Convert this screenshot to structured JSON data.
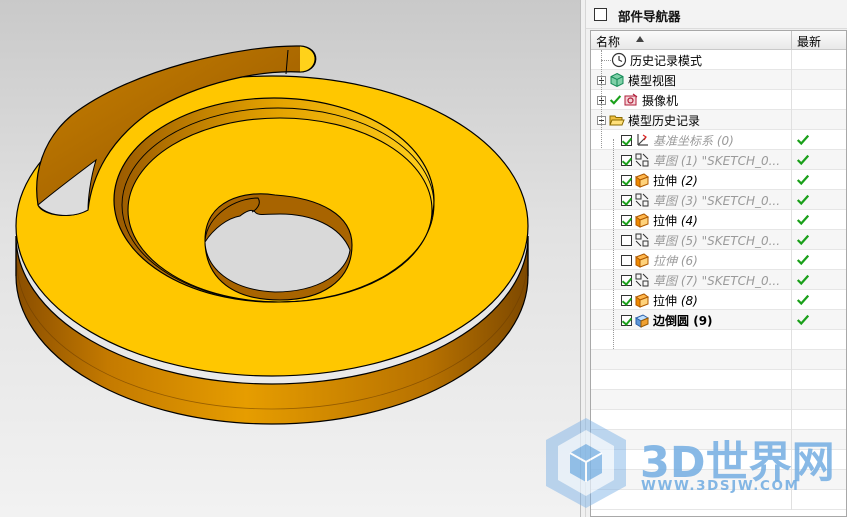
{
  "navigator": {
    "title": "部件导航器",
    "columns": {
      "name": "名称",
      "latest": "最新"
    },
    "items": [
      {
        "label": "历史记录模式",
        "icon": "clock-icon",
        "level": 0
      },
      {
        "label": "模型视图",
        "icon": "model-views-icon",
        "level": 0,
        "expander": "plus"
      },
      {
        "label": "摄像机",
        "icon": "camera-icon",
        "level": 0,
        "expander": "plus",
        "check": true
      },
      {
        "label": "模型历史记录",
        "icon": "folder-open-icon",
        "level": 0,
        "expander": "minus"
      },
      {
        "label": "基准坐标系",
        "num": "(0)",
        "icon": "datum-csys-icon",
        "checked": true,
        "latest": true
      },
      {
        "label": "草图",
        "num": "(1) \"SKETCH_0...",
        "icon": "sketch-icon",
        "checked": true,
        "latest": true
      },
      {
        "label": "拉伸",
        "num": "(2)",
        "icon": "extrude-icon",
        "checked": true,
        "latest": true
      },
      {
        "label": "草图",
        "num": "(3) \"SKETCH_0...",
        "icon": "sketch-icon",
        "checked": true,
        "latest": true
      },
      {
        "label": "拉伸",
        "num": "(4)",
        "icon": "extrude-icon",
        "checked": true,
        "latest": true
      },
      {
        "label": "草图",
        "num": "(5) \"SKETCH_0...",
        "icon": "sketch-icon",
        "checked": false,
        "latest": true
      },
      {
        "label": "拉伸",
        "num": "(6)",
        "icon": "extrude-icon",
        "checked": false,
        "latest": true
      },
      {
        "label": "草图",
        "num": "(7) \"SKETCH_0...",
        "icon": "sketch-icon",
        "checked": true,
        "latest": true
      },
      {
        "label": "拉伸",
        "num": "(8)",
        "icon": "extrude-icon",
        "checked": true,
        "latest": true
      },
      {
        "label": "边倒圆",
        "num": "(9)",
        "icon": "edge-blend-icon",
        "checked": true,
        "latest": true
      }
    ]
  },
  "watermark": {
    "brand": "3D世界网",
    "url": "WWW.3DSJW.COM"
  },
  "colors": {
    "part_face": "#ffc700",
    "part_side": "#d08a00",
    "check_green": "#1aa01a"
  }
}
